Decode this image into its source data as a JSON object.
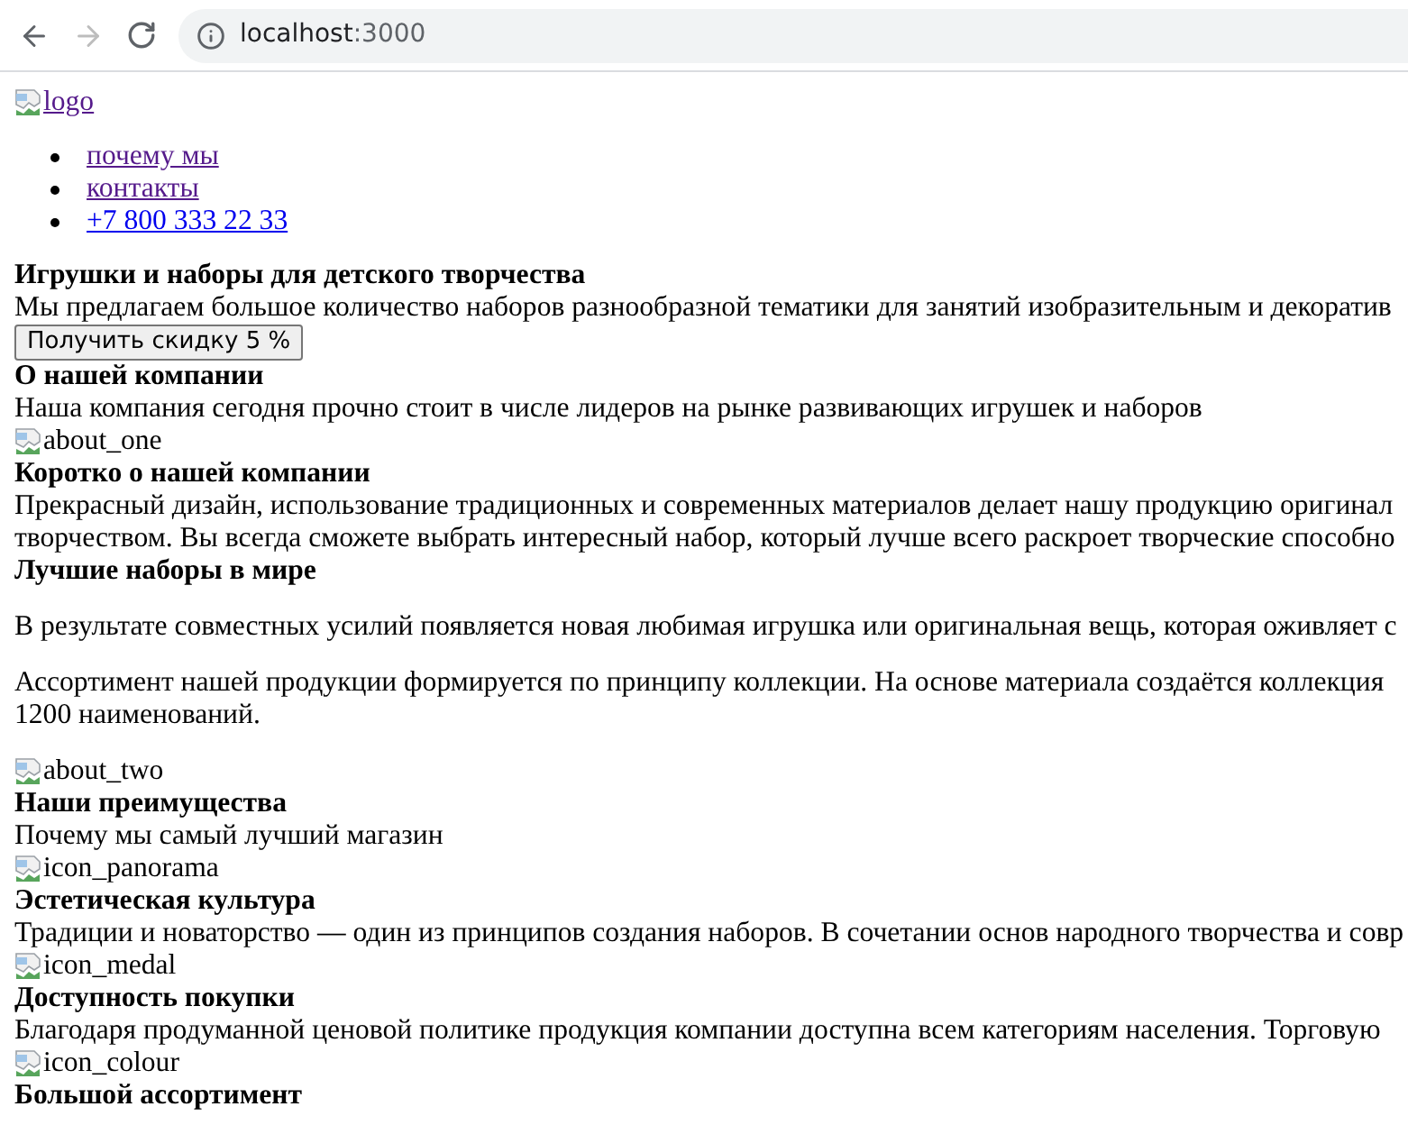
{
  "browser": {
    "back_disabled": false,
    "forward_disabled": true,
    "host": "localhost",
    "port": ":3000"
  },
  "logo": {
    "alt": "logo"
  },
  "nav": [
    {
      "label": "почему мы",
      "visited": true
    },
    {
      "label": "контакты",
      "visited": true
    },
    {
      "label": "+7 800 333 22 33",
      "visited": false
    }
  ],
  "content": [
    {
      "kind": "heading",
      "text": "Игрушки и наборы для детского творчества"
    },
    {
      "kind": "text",
      "text": "Мы предлагаем большое количество наборов разнообразной тематики для занятий изобразительным и декоратив"
    },
    {
      "kind": "button",
      "text": "Получить скидку 5 %"
    },
    {
      "kind": "heading",
      "text": "О нашей компании"
    },
    {
      "kind": "text",
      "text": "Наша компания сегодня прочно стоит в числе лидеров на рынке развивающих игрушек и наборов"
    },
    {
      "kind": "image",
      "text": "about_one"
    },
    {
      "kind": "heading",
      "text": "Коротко о нашей компании"
    },
    {
      "kind": "text",
      "text": "Прекрасный дизайн, использование традиционных и современных материалов делает нашу продукцию оригинал"
    },
    {
      "kind": "text",
      "text": "творчеством. Вы всегда сможете выбрать интересный набор, который лучше всего раскроет творческие способно"
    },
    {
      "kind": "heading",
      "text": "Лучшие наборы в мире"
    },
    {
      "kind": "paragraph",
      "text": "В результате совместных усилий появляется новая любимая игрушка или оригинальная вещь, которая оживляет с"
    },
    {
      "kind": "paragraph",
      "lines": [
        "Ассортимент нашей продукции формируется по принципу коллекции. На основе материала создаётся коллекция",
        "1200 наименований."
      ]
    },
    {
      "kind": "image",
      "text": "about_two"
    },
    {
      "kind": "heading",
      "text": "Наши преимущества"
    },
    {
      "kind": "text",
      "text": "Почему мы самый лучший магазин"
    },
    {
      "kind": "image",
      "text": "icon_panorama"
    },
    {
      "kind": "heading",
      "text": "Эстетическая культура"
    },
    {
      "kind": "text",
      "text": "Традиции и новаторство — один из принципов создания наборов. В сочетании основ народного творчества и совр"
    },
    {
      "kind": "image",
      "text": "icon_medal"
    },
    {
      "kind": "heading",
      "text": "Доступность покупки"
    },
    {
      "kind": "text",
      "text": "Благодаря продуманной ценовой политике продукция компании доступна всем категориям населения. Торговую"
    },
    {
      "kind": "image",
      "text": "icon_colour"
    },
    {
      "kind": "heading",
      "text": "Большой ассортимент"
    }
  ]
}
